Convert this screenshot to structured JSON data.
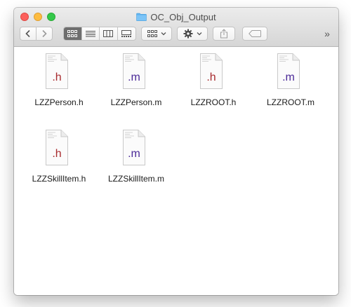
{
  "window": {
    "title": "OC_Obj_Output"
  },
  "toolbar": {
    "back_icon": "chevron-left-icon",
    "forward_icon": "chevron-right-icon",
    "view_modes": [
      "icon-view",
      "list-view",
      "column-view",
      "gallery-view"
    ],
    "active_view": "icon-view",
    "overflow_label": "»"
  },
  "files": [
    {
      "name": "LZZPerson.h",
      "ext": ".h",
      "color": "#a82a2e"
    },
    {
      "name": "LZZPerson.m",
      "ext": ".m",
      "color": "#4b2a98"
    },
    {
      "name": "LZZROOT.h",
      "ext": ".h",
      "color": "#a82a2e"
    },
    {
      "name": "LZZROOT.m",
      "ext": ".m",
      "color": "#4b2a98"
    },
    {
      "name": "LZZSkillItem.h",
      "ext": ".h",
      "color": "#a82a2e"
    },
    {
      "name": "LZZSkillItem.m",
      "ext": ".m",
      "color": "#4b2a98"
    }
  ]
}
